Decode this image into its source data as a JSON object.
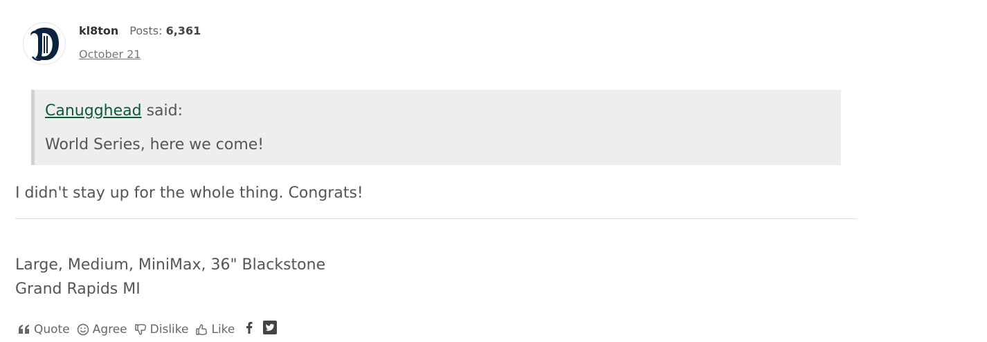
{
  "author": {
    "name": "kl8ton",
    "posts_label": "Posts:",
    "posts_count": "6,361",
    "date": "October 21",
    "avatar_icon": "detroit-tigers-d-logo"
  },
  "quote": {
    "author": "Canugghead",
    "said_label": "said:",
    "text": "World Series, here we come!"
  },
  "body": "I didn't stay up for the whole thing. Congrats!",
  "signature": {
    "line1": "Large, Medium, MiniMax, 36\" Blackstone",
    "line2": "Grand Rapids MI"
  },
  "reactions": [
    {
      "label": "Quote",
      "icon": "quote-icon"
    },
    {
      "label": "Agree",
      "icon": "smiley-icon"
    },
    {
      "label": "Dislike",
      "icon": "thumbs-down-icon"
    },
    {
      "label": "Like",
      "icon": "thumbs-up-icon"
    }
  ],
  "share": [
    {
      "icon": "facebook-icon"
    },
    {
      "icon": "twitter-icon"
    }
  ],
  "colors": {
    "link_green": "#0a5c36",
    "quote_bg": "#eeeeee",
    "avatar_navy": "#0c2340"
  }
}
